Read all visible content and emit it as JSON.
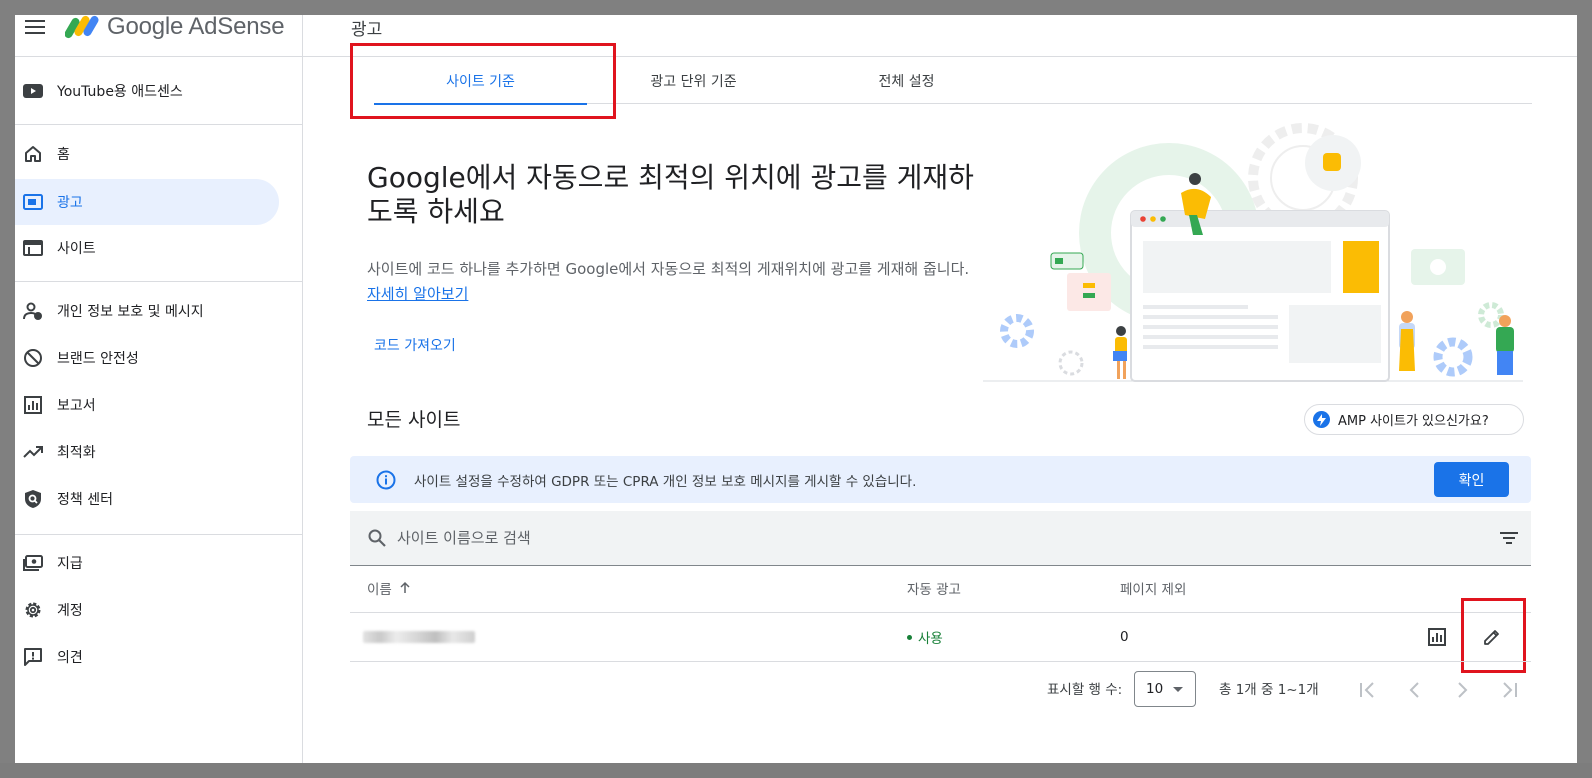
{
  "app": {
    "name": "Google AdSense"
  },
  "header": {
    "title": "광고"
  },
  "sidebar": {
    "items": [
      {
        "label": "YouTube용 애드센스",
        "icon": "youtube-icon"
      },
      {
        "label": "홈",
        "icon": "home-icon"
      },
      {
        "label": "광고",
        "icon": "ads-icon",
        "active": true
      },
      {
        "label": "사이트",
        "icon": "sites-icon"
      },
      {
        "label": "개인 정보 보호 및 메시지",
        "icon": "privacy-person-icon"
      },
      {
        "label": "브랜드 안전성",
        "icon": "block-icon"
      },
      {
        "label": "보고서",
        "icon": "bar-chart-icon"
      },
      {
        "label": "최적화",
        "icon": "trending-up-icon"
      },
      {
        "label": "정책 센터",
        "icon": "policy-shield-icon"
      },
      {
        "label": "지급",
        "icon": "payments-icon"
      },
      {
        "label": "계정",
        "icon": "gear-icon"
      },
      {
        "label": "의견",
        "icon": "feedback-icon"
      }
    ]
  },
  "tabs": [
    {
      "label": "사이트 기준",
      "active": true
    },
    {
      "label": "광고 단위 기준"
    },
    {
      "label": "전체 설정"
    }
  ],
  "hero": {
    "title": "Google에서 자동으로 최적의 위치에 광고를 게재하도록 하세요",
    "description": "사이트에 코드 하나를 추가하면 Google에서 자동으로 최적의 게재위치에 광고를 게재해 줍니다.",
    "learn_more": "자세히 알아보기",
    "get_code": "코드 가져오기"
  },
  "all_sites": {
    "title": "모든 사이트",
    "amp_chip": "AMP 사이트가 있으신가요?"
  },
  "banner": {
    "text": "사이트 설정을 수정하여 GDPR 또는 CPRA 개인 정보 보호 메시지를 게시할 수 있습니다.",
    "button": "확인"
  },
  "search": {
    "placeholder": "사이트 이름으로 검색"
  },
  "table": {
    "columns": [
      "이름",
      "자동 광고",
      "페이지 제외"
    ],
    "rows": [
      {
        "name": "",
        "auto_ads": "사용",
        "page_exclusions": "0"
      }
    ]
  },
  "pagination": {
    "rows_label": "표시할 행 수:",
    "rows_value": "10",
    "range": "총 1개 중 1~1개"
  },
  "colors": {
    "accent": "#1a73e8",
    "highlight": "#e0141e",
    "status_green": "#188038"
  }
}
